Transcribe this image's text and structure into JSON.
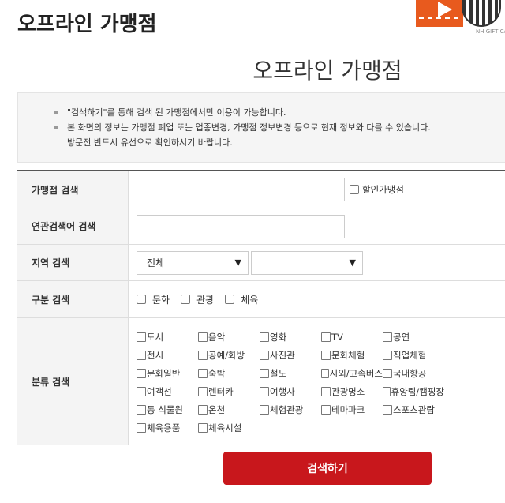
{
  "header": {
    "title": "오프라인 가맹점",
    "banner_text": "NH GIFT CA"
  },
  "main": {
    "heading": "오프라인 가맹점",
    "notice": [
      "\"검색하기\"를 통해 검색 된 가맹점에서만 이용이 가능합니다.",
      "본 화면의 정보는 가맹점 폐업 또는 업종변경, 가맹점 정보변경 등으로 현재 정보와 다를 수 있습니다.",
      "방문전 반드시 유선으로 확인하시기 바랍니다."
    ]
  },
  "form": {
    "merchant_search": {
      "label": "가맹점 검색",
      "value": "",
      "discount_label": "할인가맹점"
    },
    "keyword_search": {
      "label": "연관검색어 검색",
      "value": ""
    },
    "region_search": {
      "label": "지역 검색",
      "select1": "전체",
      "select2": ""
    },
    "type_search": {
      "label": "구분 검색",
      "options": [
        "문화",
        "관광",
        "체육"
      ]
    },
    "category_search": {
      "label": "분류 검색",
      "options": [
        "도서",
        "음악",
        "영화",
        "TV",
        "공연",
        "전시",
        "공예/화방",
        "사진관",
        "문화체험",
        "직업체험",
        "문화일반",
        "숙박",
        "철도",
        "시외/고속버스",
        "국내항공",
        "여객선",
        "렌터카",
        "여행사",
        "관광명소",
        "휴양림/캠핑장",
        "동 식물원",
        "온천",
        "체험관광",
        "테마파크",
        "스포츠관람",
        "체육용품",
        "체육시설"
      ]
    }
  },
  "actions": {
    "search_label": "검색하기"
  }
}
